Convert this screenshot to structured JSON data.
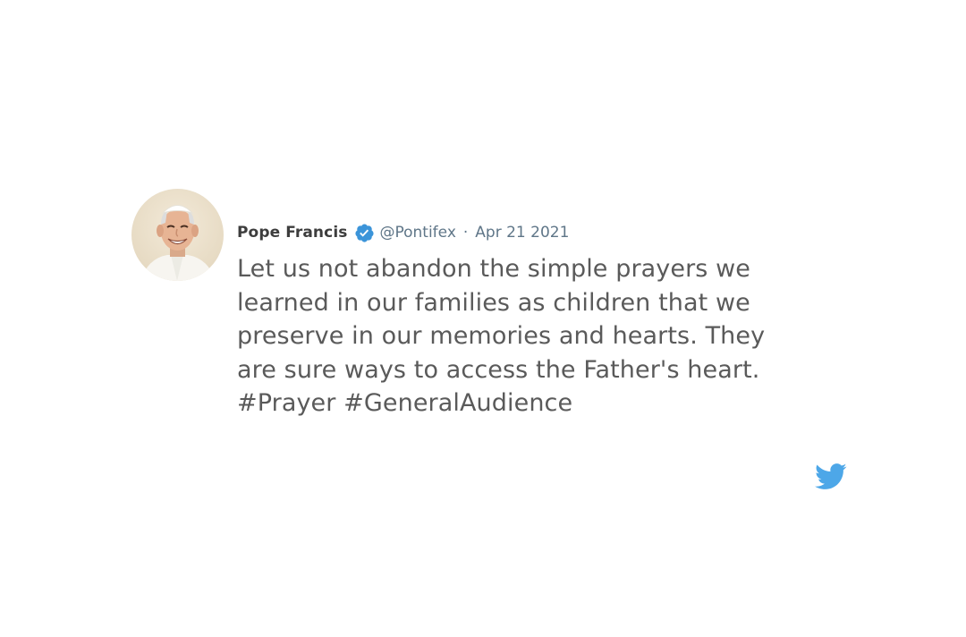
{
  "tweet": {
    "author": {
      "display_name": "Pope Francis",
      "handle": "@Pontifex",
      "verified": true,
      "avatar_icon": "profile-photo"
    },
    "separator": "·",
    "date": "Apr 21 2021",
    "text_lines": [
      "Let us not abandon the simple prayers we",
      "learned in our families as children that we",
      "preserve in our memories and hearts. They",
      "are sure ways to access the Father's heart."
    ],
    "hashtags": [
      "#Prayer",
      "#GeneralAudience"
    ]
  },
  "branding": {
    "icon": "twitter-bird-icon",
    "color": "#4da7e8"
  },
  "colors": {
    "text": "#5a5a5a",
    "name": "#3d3d3d",
    "meta": "#5f7688",
    "verified": "#3b94d9"
  }
}
